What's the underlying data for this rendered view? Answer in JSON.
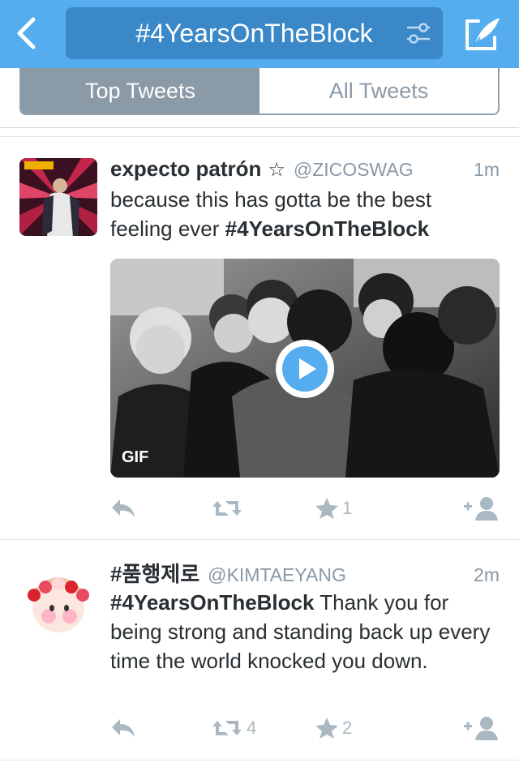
{
  "header": {
    "search_text": "#4YearsOnTheBlock",
    "back_icon": "chevron-left-icon",
    "filter_icon": "filter-sliders-icon",
    "compose_icon": "compose-quill-icon",
    "bar_color": "#55acee"
  },
  "tabs": [
    {
      "label": "Top Tweets",
      "active": true
    },
    {
      "label": "All Tweets",
      "active": false
    }
  ],
  "tweets": [
    {
      "name": "expecto patrón",
      "star": "☆",
      "handle": "@ZICOSWAG",
      "time": "1m",
      "text_plain": "because this has gotta be the best feeling ever ",
      "text_hashtag": "#4YearsOnTheBlock",
      "media_badge": "GIF",
      "retweet_count": "",
      "favorite_count": "1"
    },
    {
      "name": "#품행제로",
      "handle": "@KIMTAEYANG",
      "time": "2m",
      "text_hashtag": "#4YearsOnTheBlock",
      "text_plain": " Thank you for being strong and standing back up every time the world knocked you down.",
      "retweet_count": "4",
      "favorite_count": "2"
    }
  ]
}
